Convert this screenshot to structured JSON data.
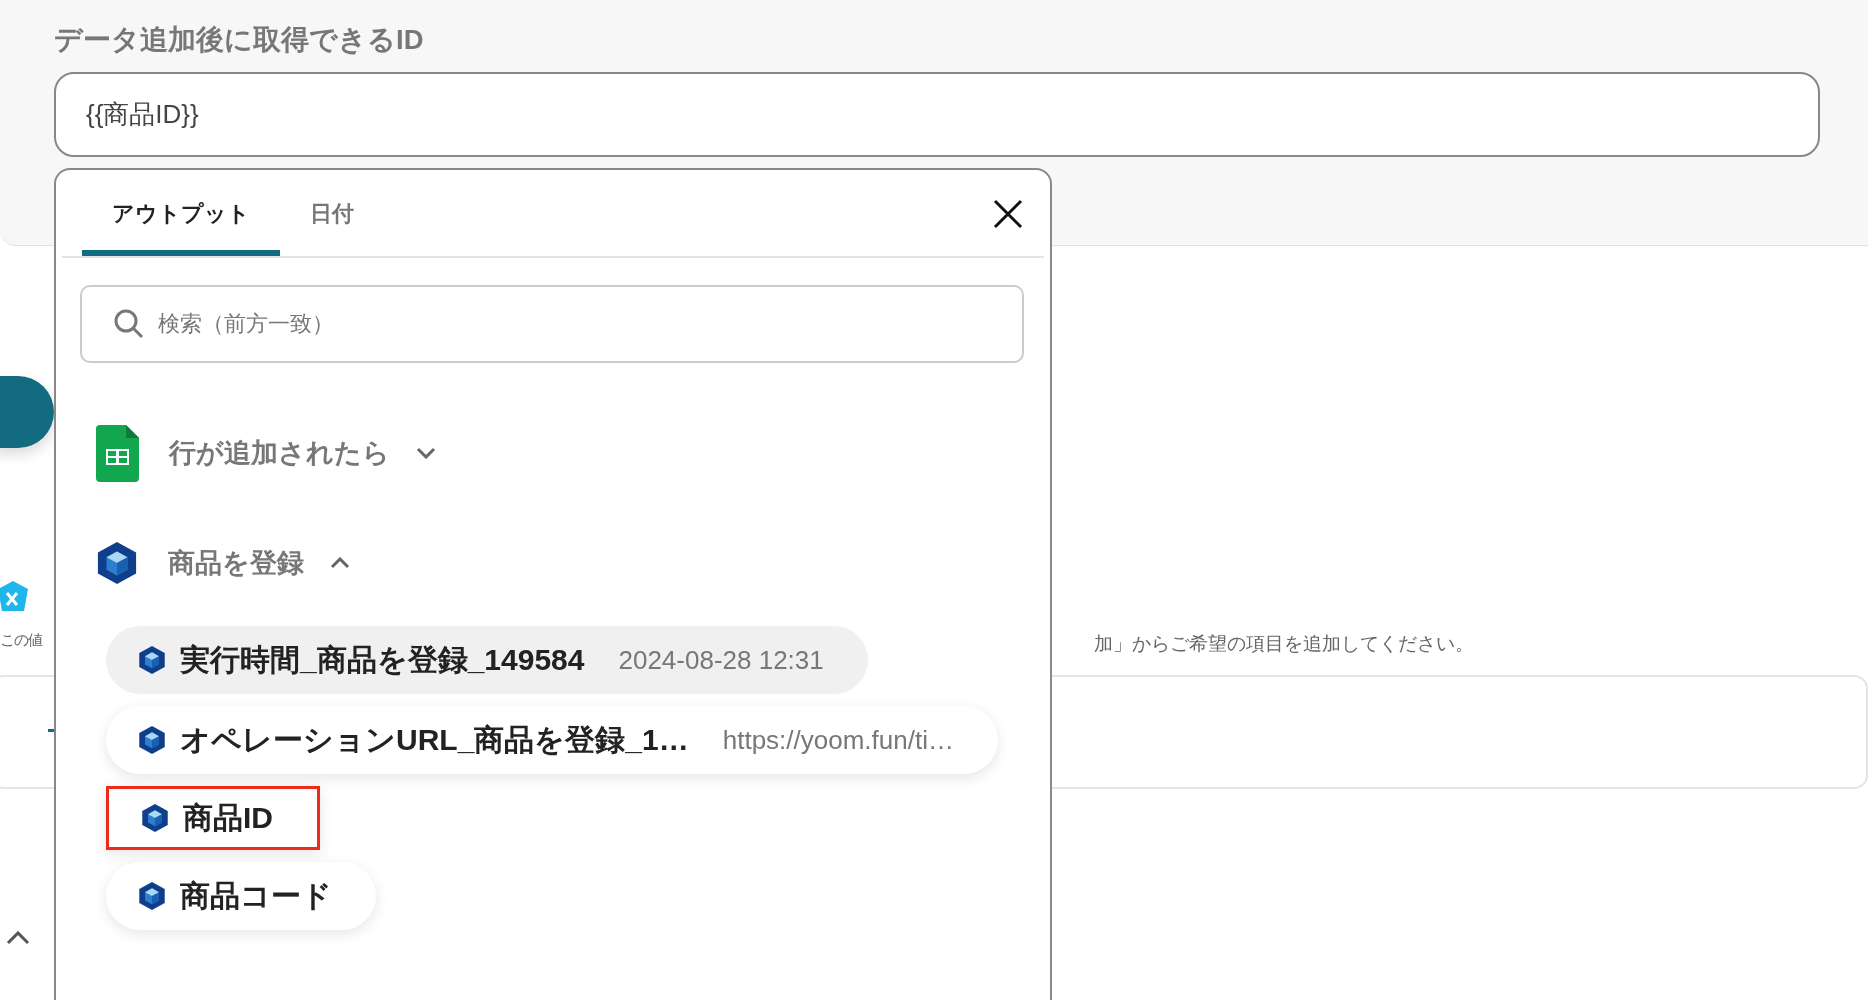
{
  "field": {
    "label": "データ追加後に取得できるID",
    "value": "{{商品ID}}"
  },
  "background": {
    "left_text": "この値",
    "right_text": "加」からご希望の項目を追加してください。"
  },
  "popup": {
    "tabs": [
      {
        "label": "アウトプット",
        "selected": true
      },
      {
        "label": "日付",
        "selected": false
      }
    ],
    "search": {
      "placeholder": "検索（前方一致）"
    },
    "groups": [
      {
        "kind": "sheet",
        "title": "行が追加されたら",
        "expanded": false
      },
      {
        "kind": "cube",
        "title": "商品を登録",
        "expanded": true,
        "items": [
          {
            "name": "実行時間_商品を登録_149584",
            "value": "2024-08-28 12:31",
            "active": true,
            "marked": false
          },
          {
            "name": "オペレーションURL_商品を登録_1…",
            "value": "https://yoom.fun/ti…",
            "active": false,
            "marked": false
          },
          {
            "name": "商品ID",
            "active": false,
            "marked": true
          },
          {
            "name": "商品コード",
            "active": false,
            "marked": false
          }
        ]
      }
    ]
  }
}
